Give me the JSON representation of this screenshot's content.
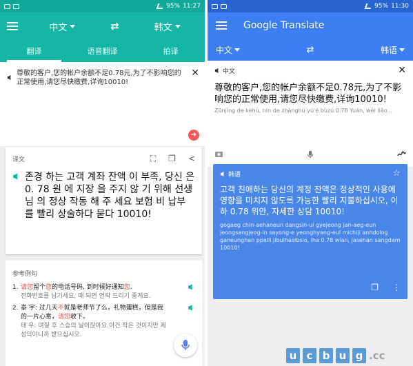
{
  "left": {
    "status": {
      "percent": "95%",
      "time": "11:27"
    },
    "toolbar": {
      "source_lang": "中文",
      "target_lang": "韩文"
    },
    "tabs": [
      {
        "label": "翻译",
        "active": true
      },
      {
        "label": "语音翻译",
        "active": false
      },
      {
        "label": "拍译",
        "active": false
      }
    ],
    "input": {
      "text": "尊敬的客户,您的帐户余额不足0.78元,为了不影响您的正常使用,请您尽快缴费,详询10010!"
    },
    "result": {
      "label": "译文",
      "text": "존경 하는 고객 계좌 잔액 이 부족, 당신 은 0. 78 원 에 지장 을 주지 않 기 위해 선생님 의 정상 작동 해 주 세요 보험 비 납부 를 빨리 상술하다 묻다 10010!"
    },
    "examples": {
      "title": "参考例句",
      "items": [
        {
          "num": "1.",
          "zh_parts": [
            "请您",
            "留个",
            "您",
            "的电话号码, 到时候好通知",
            "您",
            "."
          ],
          "ko": "전화번호를 남기세요, 때 되면 연락 드리기 좋게요."
        },
        {
          "num": "2.",
          "zh_parts": [
            "泰 宇: 过几天",
            "不",
            "就是老师节了么，礼物蛋糕，但是我的一片心意，",
            "请您",
            "收下。"
          ],
          "ko": "태 우: 며칠 후 스승의 날이잖아요.이건 작은 것이지만 제 성의이니까 받으십시오."
        }
      ]
    }
  },
  "right": {
    "status": {
      "percent": "95%",
      "time": "11:30"
    },
    "appbar": {
      "title": "Google Translate"
    },
    "langbar": {
      "source_lang": "中文",
      "target_lang": "韩语"
    },
    "source": {
      "label": "中文",
      "text": "尊敬的客户,您的帐户余额不足0.78元,为了不影响您的正常使用,请您尽快缴费,详询10010!",
      "romanization": "Zūnjìng de kèhù, nín de zhànghù yú'é bùzú 0.78 Yuán, wèi liǎo..."
    },
    "translation": {
      "label": "韩语",
      "text": "고객 친애하는 당신의 계정 잔액은 정상적인 사용에 영향을 미치지 않도록 가능한 빨리 지불하십시오, 이하 0.78 위안, 자세한 상담 10010!",
      "romanization": "gogaeg chin-aehaneun dangsin-ui gyejeong jan-aeg-eun jeongsangjeog-in sayong-e yeonghyang-eul michiji anhdolog ganeunghan ppalli jibulhasibsio, iha 0.78 wian, jasehan sangdam 10010!"
    }
  },
  "watermark": {
    "letters": [
      "u",
      "c",
      "b",
      "u",
      "g"
    ],
    "suffix": ".cc"
  },
  "colors": {
    "left_primary": "#15b6a6",
    "right_primary": "#3d7ff2",
    "highlight": "#e05050"
  }
}
